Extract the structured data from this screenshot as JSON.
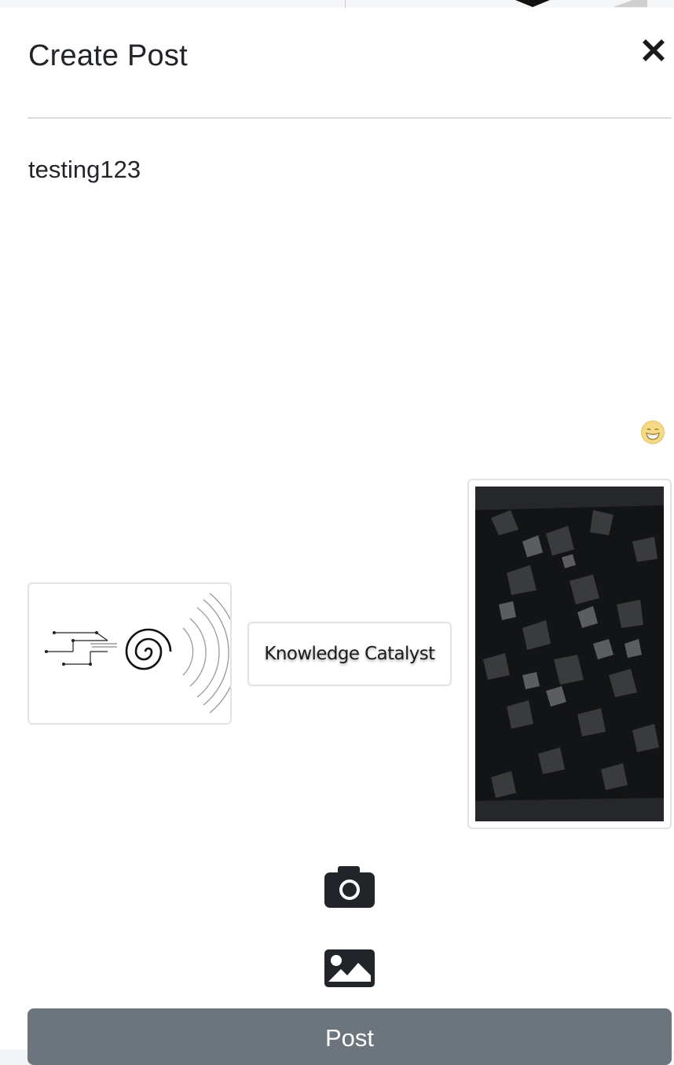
{
  "modal": {
    "title": "Create Post",
    "close_icon": "close-x-icon"
  },
  "post": {
    "text": "testing123",
    "emoji_icon": "grinning-face-emoji-icon"
  },
  "attachments": [
    {
      "type": "image",
      "icon": "spiral-circuit-logo"
    },
    {
      "type": "image",
      "text": "Knowledge Catalyst"
    },
    {
      "type": "image",
      "icon": "dark-rocks-photo"
    }
  ],
  "actions": {
    "camera_icon": "camera-icon",
    "gallery_icon": "image-icon",
    "post_label": "Post"
  },
  "colors": {
    "post_button_bg": "#6c757d",
    "icon_dark": "#212529",
    "thumb_border": "#e1e3e6"
  }
}
